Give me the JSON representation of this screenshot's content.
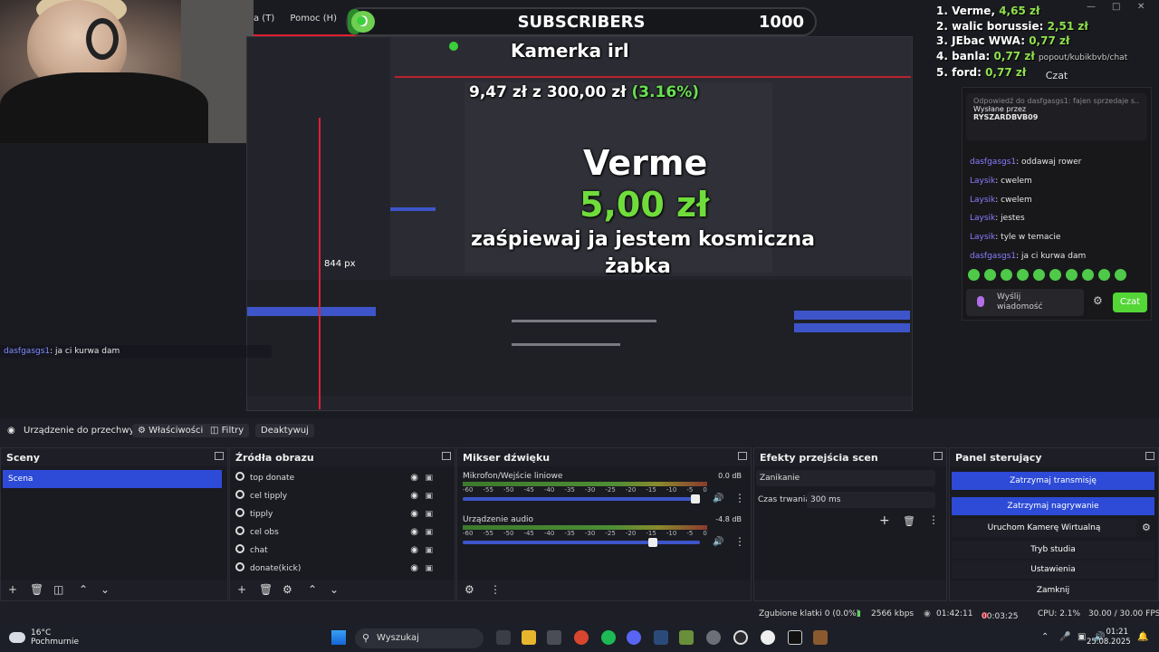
{
  "preview": {
    "menu_strip": [
      "a (T)",
      "Pomoc (H)"
    ],
    "subscribers_bar": {
      "current": "0",
      "label": "SUBSCRIBERS",
      "goal": "1000"
    },
    "kamerka_text": "Kamerka irl",
    "donation_progress": {
      "amount": "9,47 zł",
      "separator": "z",
      "goal": "300,00 zł",
      "percent": "(3.16%)"
    },
    "alert": {
      "name": "Verme",
      "amount": "5,00 zł",
      "message_line1": "zaśpiewaj ja jestem kosmiczna",
      "message_line2": "żabka"
    },
    "px_label": "844 px",
    "overlay_chat_line": {
      "user": "dasfgasgs1",
      "text": ": ja ci kurwa dam"
    },
    "leaderboard": [
      {
        "rank": "1.",
        "name": "Verme,",
        "amount": "4,65 zł"
      },
      {
        "rank": "2.",
        "name": "walic borussie:",
        "amount": "2,51 zł"
      },
      {
        "rank": "3.",
        "name": "JEbac WWA:",
        "amount": "0,77 zł"
      },
      {
        "rank": "4.",
        "name": "banla:",
        "amount": "0,77 zł"
      },
      {
        "rank": "5.",
        "name": "ford:",
        "amount": "0,77 zł"
      }
    ],
    "url_fragment": "popout/kubikbvb/chat",
    "chat": {
      "title": "Czat",
      "pinned_label": "Wysłane przez",
      "pinned_user": "RYSZARDBVB09",
      "pinned_reply": "Odpowiedź do dasfgasgs1: fajen sprzedaje s...",
      "messages": [
        {
          "user": "dasfgasgs1",
          "text": ": oddawaj rower"
        },
        {
          "user": "Laysik",
          "text": ": cwelem"
        },
        {
          "user": "Laysik",
          "text": ": cwelem"
        },
        {
          "user": "Laysik",
          "text": ": jestes"
        },
        {
          "user": "Laysik",
          "text": ": tyle w temacie"
        },
        {
          "user": "dasfgasgs1",
          "text": ": ja ci kurwa dam"
        }
      ],
      "input_placeholder_1": "Wyślij",
      "input_placeholder_2": "wiadomość",
      "send_label": "Czat"
    }
  },
  "toolbar": {
    "device": "Urządzenie do przechwytyw",
    "properties": "Właściwości",
    "filters": "Filtry",
    "deactivate": "Deaktywuj"
  },
  "docks": {
    "scenes": {
      "title": "Sceny",
      "items": [
        "Scena"
      ]
    },
    "sources": {
      "title": "Źródła obrazu",
      "items": [
        "top donate",
        "cel tipply",
        "tipply",
        "cel obs",
        "chat",
        "donate(kick)"
      ]
    },
    "mixer": {
      "title": "Mikser dźwięku",
      "channels": [
        {
          "name": "Mikrofon/Wejście liniowe",
          "db": "0.0 dB",
          "volume_fraction": 0.98
        },
        {
          "name": "Urządzenie audio",
          "db": "-4.8 dB",
          "volume_fraction": 0.8
        }
      ],
      "ticks": [
        "-60",
        "-55",
        "-50",
        "-45",
        "-40",
        "-35",
        "-30",
        "-25",
        "-20",
        "-15",
        "-10",
        "-5",
        "0"
      ]
    },
    "transitions": {
      "title": "Efekty przejścia scen",
      "type": "Zanikanie",
      "duration_label": "Czas trwania",
      "duration_value": "300 ms"
    },
    "controls": {
      "title": "Panel sterujący",
      "buttons": [
        "Zatrzymaj transmisję",
        "Zatrzymaj nagrywanie",
        "Uruchom Kamerę Wirtualną",
        "Tryb studia",
        "Ustawienia",
        "Zamknij"
      ]
    }
  },
  "status": {
    "dropped": "Zgubione klatki 0 (0.0%)",
    "bitrate": "2566 kbps",
    "stream_time": "01:42:11",
    "rec_time": "00:03:25",
    "cpu": "CPU: 2.1%",
    "fps": "30.00 / 30.00 FPS"
  },
  "taskbar": {
    "temperature": "16°C",
    "weather": "Pochmurnie",
    "search_label": "Wyszukaj",
    "time": "01:21",
    "date": "25.08.2025"
  },
  "colors": {
    "accent_blue": "#2d4bd6",
    "green": "#53d636",
    "red": "#e02030"
  }
}
